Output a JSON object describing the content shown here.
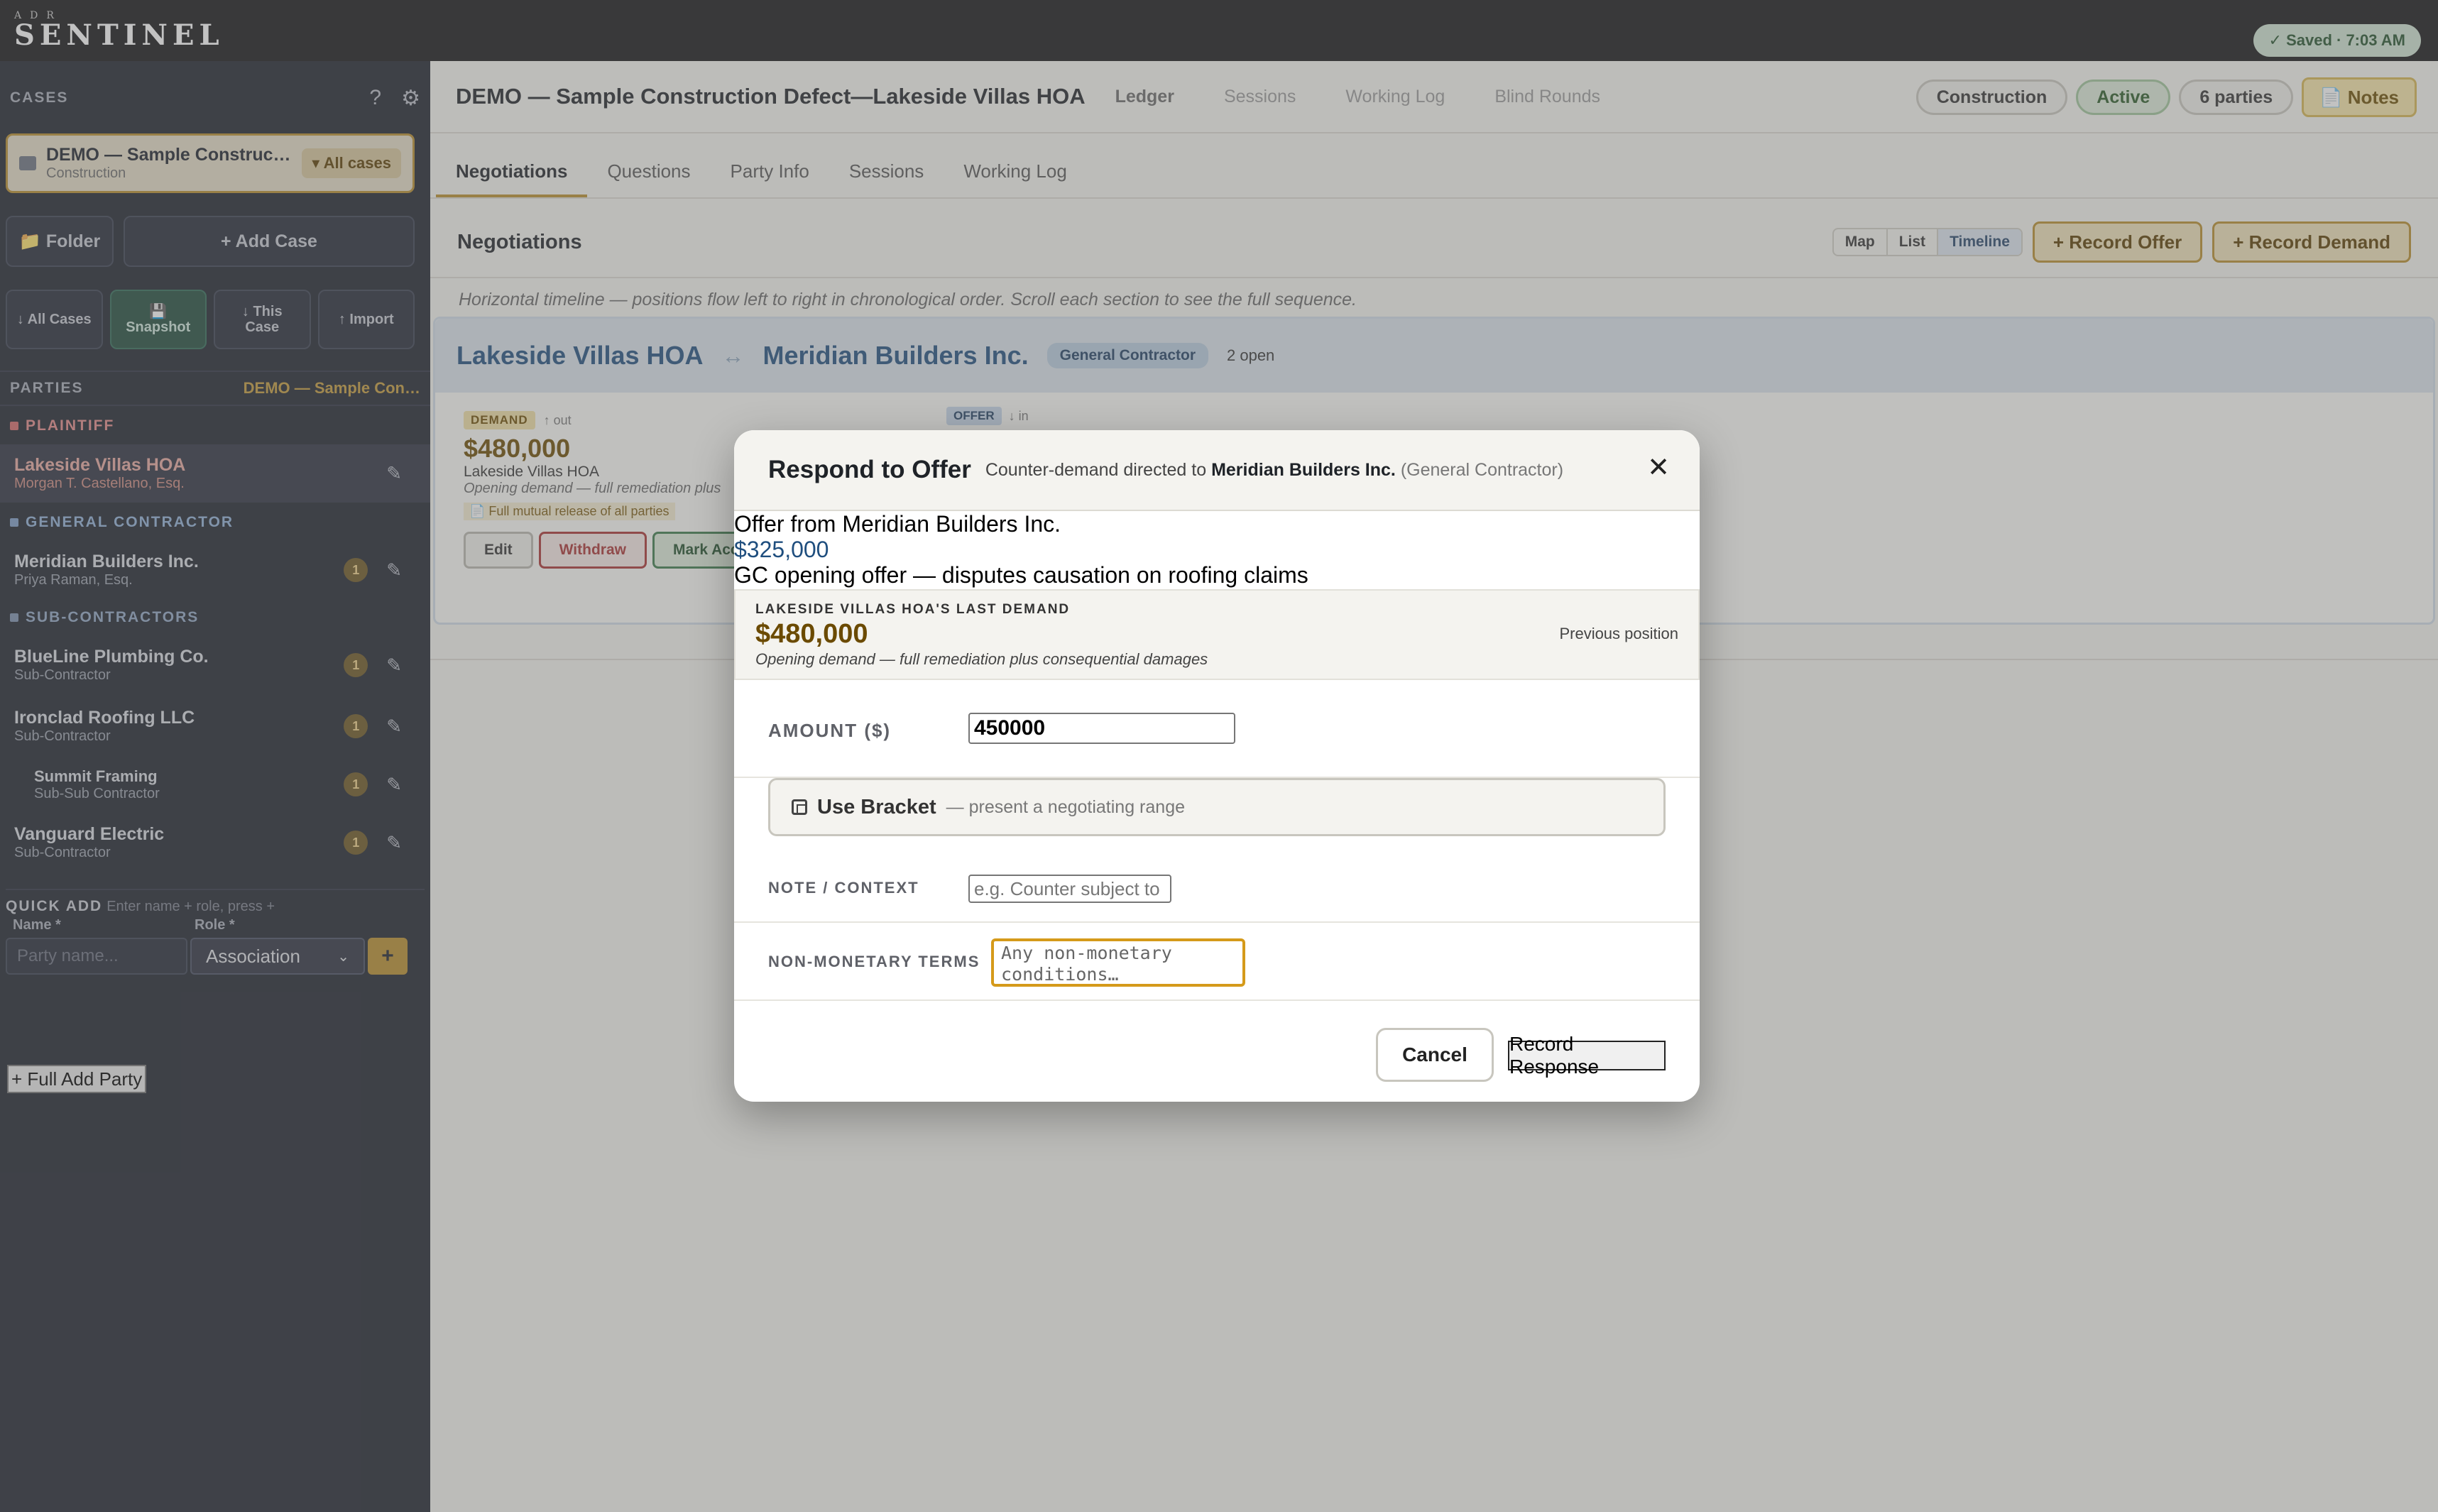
{
  "topbar": {
    "logo_small": "ADR",
    "logo_big": "SENTINEL",
    "saved": "✓ Saved · 7:03 AM"
  },
  "sidebar": {
    "cases_heading": "CASES",
    "help_icon": "?",
    "settings_icon": "⚙",
    "current_case": {
      "title": "DEMO — Sample Construct…",
      "type": "Construction",
      "all_cases": "▾ All cases"
    },
    "folder_btn": "📁 Folder",
    "add_case_btn": "+ Add Case",
    "actions": [
      {
        "line1": "↓ All Cases",
        "line2": ""
      },
      {
        "line1": "💾",
        "line2": "Snapshot"
      },
      {
        "line1": "↓ This",
        "line2": "Case"
      },
      {
        "line1": "↑ Import",
        "line2": ""
      }
    ],
    "parties_heading": "PARTIES",
    "parties_case": "DEMO — Sample Con…",
    "roles": {
      "plaintiff": "PLAINTIFF",
      "gc": "GENERAL CONTRACTOR",
      "subs": "SUB-CONTRACTORS"
    },
    "parties": [
      {
        "name": "Lakeside Villas HOA",
        "sub": "Morgan T. Castellano, Esq.",
        "count": ""
      },
      {
        "name": "Meridian Builders Inc.",
        "sub": "Priya Raman, Esq.",
        "count": "1"
      },
      {
        "name": "BlueLine Plumbing Co.",
        "sub": "Sub-Contractor",
        "count": "1"
      },
      {
        "name": "Ironclad Roofing LLC",
        "sub": "Sub-Contractor",
        "count": "1"
      },
      {
        "name": "Summit Framing",
        "sub": "Sub-Sub Contractor",
        "count": "1"
      },
      {
        "name": "Vanguard Electric",
        "sub": "Sub-Contractor",
        "count": "1"
      }
    ],
    "pencil": "✎",
    "quick_add": {
      "label": "QUICK ADD",
      "hint": "Enter name + role, press +",
      "name_label": "Name *",
      "role_label": "Role *",
      "name_placeholder": "Party name...",
      "role_value": "Association",
      "plus": "+"
    },
    "full_add": "+ Full Add Party"
  },
  "header": {
    "title": "DEMO — Sample Construction Defect—Lakeside Villas HOA",
    "nav": [
      "Ledger",
      "Sessions",
      "Working Log",
      "Blind Rounds"
    ],
    "pills": [
      "Construction",
      "Active",
      "6 parties"
    ],
    "notes": "📄 Notes"
  },
  "tabs": [
    "Negotiations",
    "Questions",
    "Party Info",
    "Sessions",
    "Working Log"
  ],
  "negotiations": {
    "title": "Negotiations",
    "views": [
      "Map",
      "List",
      "Timeline"
    ],
    "record_offer": "+ Record Offer",
    "record_demand": "+ Record Demand",
    "hint": "Horizontal timeline — positions flow left to right in chronological order. Scroll each section to see the full sequence.",
    "section": {
      "party_a": "Lakeside Villas HOA",
      "arrow": "↔",
      "party_b": "Meridian Builders Inc.",
      "badge": "General Contractor",
      "open": "2 open"
    },
    "entry": {
      "tag": "DEMAND",
      "dir": "↑ out",
      "amount": "$480,000",
      "party": "Lakeside Villas HOA",
      "note": "Opening demand — full remediation plus",
      "terms": "📄 Full mutual release of all parties",
      "edit": "Edit",
      "withdraw": "Withdraw",
      "accept": "Mark Accepted"
    },
    "offer_tag": "OFFER",
    "offer_dir": "↓ in"
  },
  "modal": {
    "title": "Respond to Offer",
    "sub_prefix": "Counter-demand directed to",
    "sub_party": "Meridian Builders Inc.",
    "sub_role": "(General Contractor)",
    "close": "✕",
    "offer_from": "Offer from Meridian Builders Inc.",
    "offer_amount": "$325,000",
    "offer_note": "GC opening offer — disputes causation on roofing claims",
    "last_label": "LAKESIDE VILLAS HOA'S LAST DEMAND",
    "last_amount": "$480,000",
    "last_note": "Opening demand — full remediation plus consequential damages",
    "prev_label": "Previous position",
    "amount_label": "AMOUNT ($)",
    "amount_value": "450000",
    "bracket_label": "Use Bracket",
    "bracket_sub": "— present a negotiating range",
    "note_label": "NOTE / CONTEXT",
    "note_placeholder": "e.g. Counter subject to",
    "terms_label": "NON-MONETARY TERMS",
    "terms_placeholder": "Any non-monetary conditions…",
    "cancel": "Cancel",
    "record": "Record Response"
  }
}
